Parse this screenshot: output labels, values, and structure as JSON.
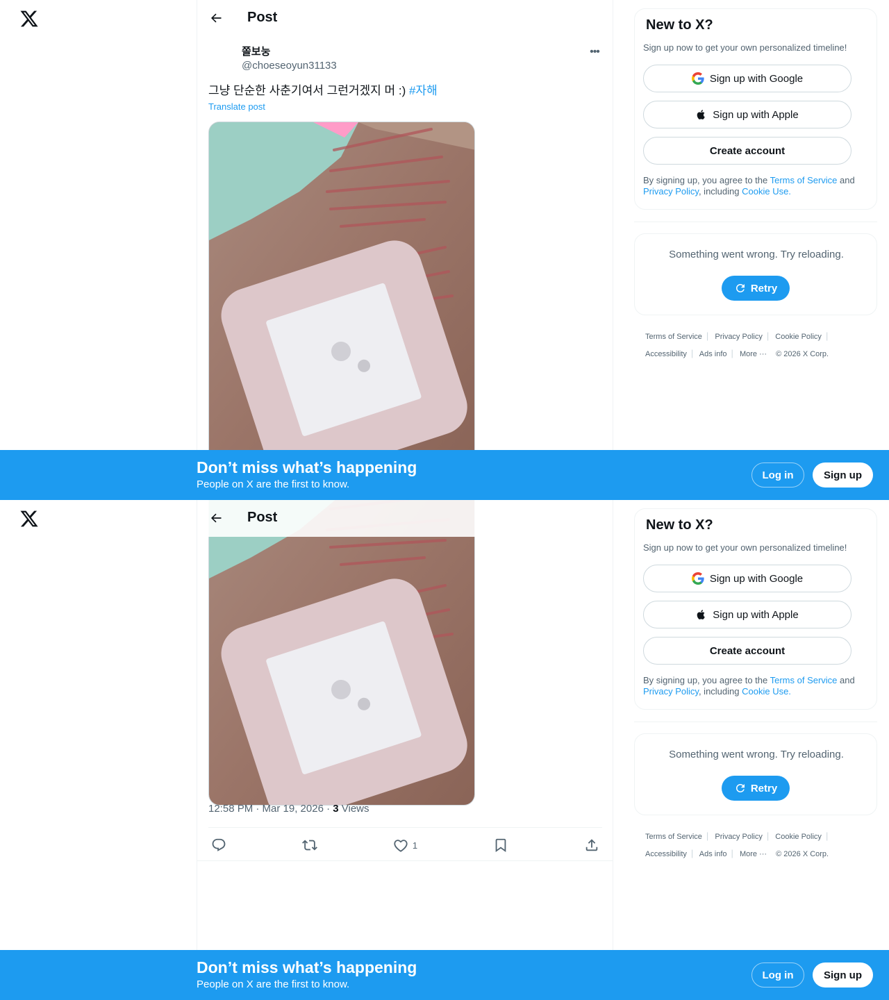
{
  "header": {
    "title": "Post"
  },
  "post": {
    "author_name": "쫄보눙",
    "author_handle": "@choeseoyun31133",
    "text": "그냥 단순한 사춘기여서 그런거겠지 머 :) ",
    "hashtag": "#자해",
    "translate": "Translate post",
    "time": "12:58 PM · Mar 19, 2026 · ",
    "views_count": "3",
    "views_label": " Views",
    "likes": "1"
  },
  "signup": {
    "title": "New to X?",
    "subtitle": "Sign up now to get your own personalized timeline!",
    "google": "Sign up with Google",
    "apple": "Sign up with Apple",
    "create": "Create account",
    "legal_prefix": "By signing up, you agree to the ",
    "terms": "Terms of Service",
    "and": " and ",
    "privacy": "Privacy Policy",
    "including": ", including ",
    "cookie": "Cookie Use."
  },
  "error": {
    "message": "Something went wrong. Try reloading.",
    "retry": "Retry"
  },
  "footer": {
    "terms": "Terms of Service",
    "privacy": "Privacy Policy",
    "cookie": "Cookie Policy",
    "accessibility": "Accessibility",
    "ads": "Ads info",
    "more": "More ···",
    "copyright": "© 2026 X Corp."
  },
  "banner": {
    "title": "Don’t miss what’s happening",
    "subtitle": "People on X are the first to know.",
    "login": "Log in",
    "signup": "Sign up"
  },
  "colors": {
    "accent": "#1d9bf0",
    "text": "#0f1419",
    "muted": "#536471",
    "border": "#eff3f4"
  },
  "icons": [
    "x-logo-icon",
    "back-arrow-icon",
    "more-icon",
    "reply-icon",
    "repost-icon",
    "like-icon",
    "bookmark-icon",
    "share-icon",
    "google-icon",
    "apple-icon",
    "refresh-icon"
  ]
}
